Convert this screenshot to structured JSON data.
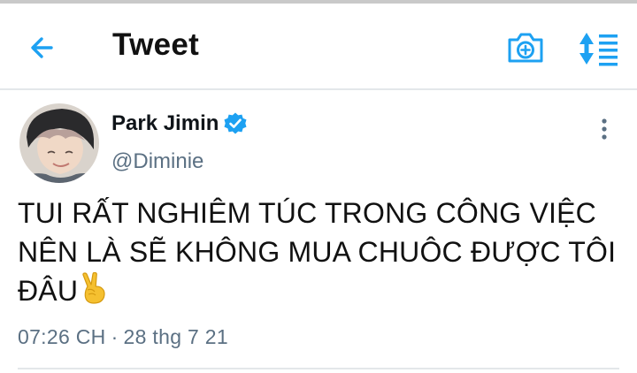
{
  "header": {
    "title": "Tweet",
    "back_icon": "arrow-left-icon",
    "camera_icon": "camera-plus-icon",
    "sort_icon": "sort-timeline-icon",
    "accent_color": "#1DA1F2"
  },
  "tweet": {
    "author_name": "Park Jimin",
    "verified": true,
    "handle": "@Diminie",
    "text": "TUI RẤT NGHIÊM TÚC TRONG CÔNG VIỆC NÊN LÀ SẼ KHÔNG MUA CHUÔC ĐƯỢC TÔI ĐÂU",
    "emoji": "victory-hand-emoji",
    "time": "07:26 CH",
    "separator": "·",
    "date": "28 thg 7 21"
  }
}
